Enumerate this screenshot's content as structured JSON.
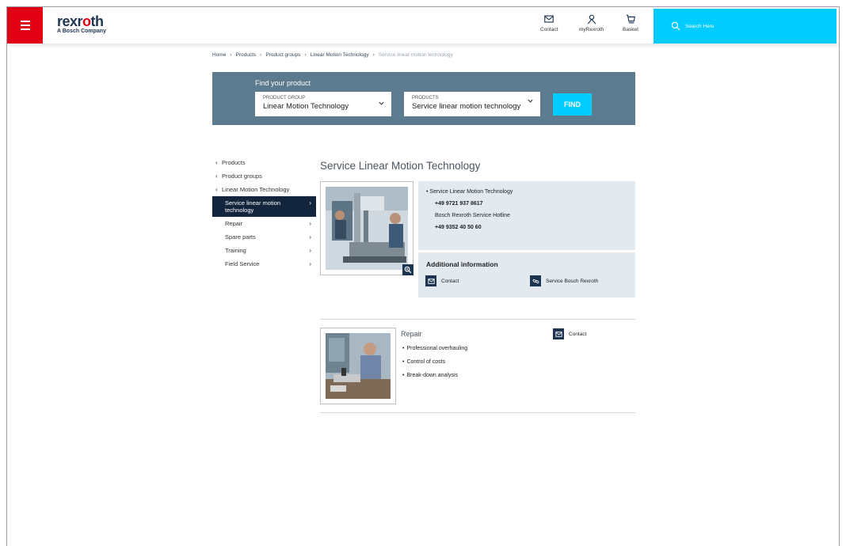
{
  "header": {
    "logo_main_pre": "rexr",
    "logo_main_o": "o",
    "logo_main_post": "th",
    "logo_sub": "A Bosch Company",
    "nav": [
      {
        "label": "Contact",
        "icon": "mail-icon"
      },
      {
        "label": "myRexroth",
        "icon": "user-icon"
      },
      {
        "label": "Basket",
        "icon": "cart-icon"
      }
    ],
    "search_placeholder": "Search Here"
  },
  "breadcrumb": {
    "items": [
      "Home",
      "Products",
      "Product groups",
      "Linear Motion Technology"
    ],
    "current": "Service linear motion technology"
  },
  "finder": {
    "title": "Find your product",
    "product_group_caption": "PRODUCT GROUP",
    "product_group_value": "Linear Motion Technology",
    "products_caption": "PRODUCTS",
    "products_value": "Service linear motion technology",
    "find_label": "FIND"
  },
  "sidenav": {
    "parents": [
      "Products",
      "Product groups",
      "Linear Motion Technology"
    ],
    "active": "Service linear motion technology",
    "children": [
      "Repair",
      "Spare parts",
      "Training",
      "Field Service"
    ]
  },
  "main": {
    "title": "Service Linear Motion Technology",
    "info": {
      "line1": "Service Linear Motion Technology",
      "phone1": "+49 9721 937 8617",
      "line2": "Bosch Rexroth Service Hotline",
      "phone2": "+49 9352 40 50 60"
    },
    "additional": {
      "title": "Additional information",
      "contact_label": "Contact",
      "link_label": "Service Bosch Rexroth"
    },
    "repair": {
      "title": "Repair",
      "contact_label": "Contact",
      "bullets": [
        "Professional overhauling",
        "Control of costs",
        "Break-down analysis"
      ]
    }
  },
  "colors": {
    "brand_red": "#e20015",
    "accent_cyan": "#00ccff",
    "dark_navy": "#13253c",
    "finder_bg": "#5c7b8e",
    "panel_bg": "#e2e9ef"
  }
}
